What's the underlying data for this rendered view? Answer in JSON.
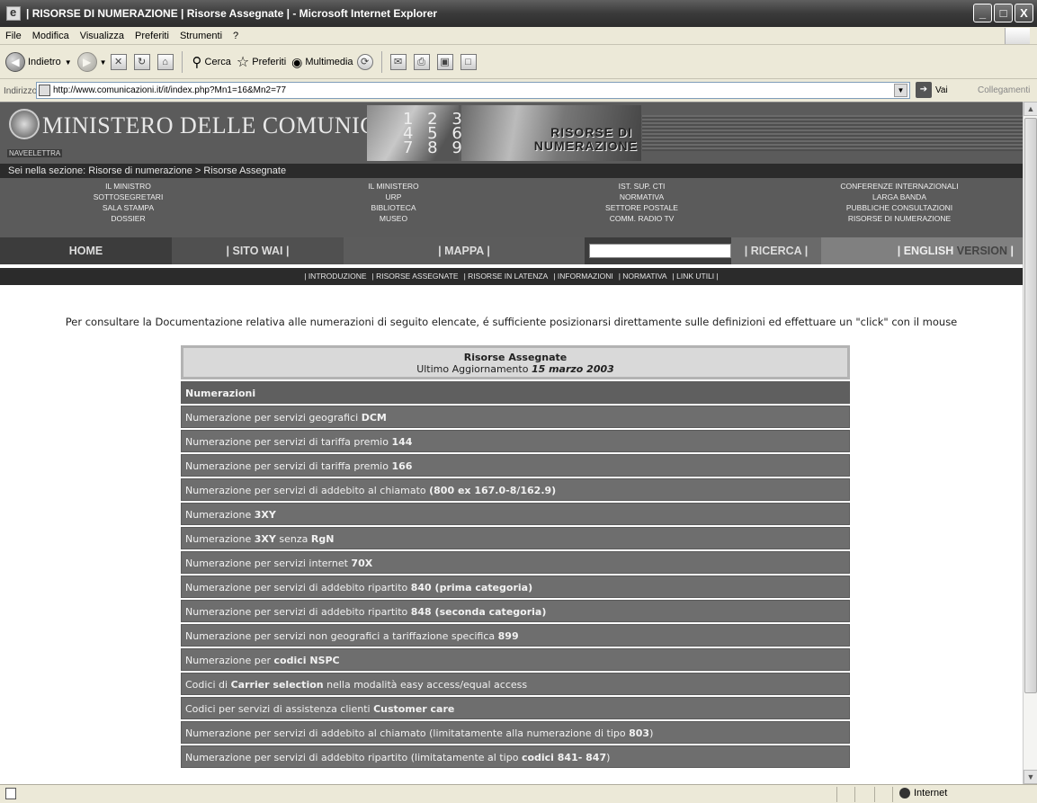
{
  "window": {
    "title": "| RISORSE DI NUMERAZIONE | Risorse Assegnate | - Microsoft Internet Explorer",
    "controls": [
      "_",
      "□",
      "X"
    ]
  },
  "menu": [
    "File",
    "Modifica",
    "Visualizza",
    "Preferiti",
    "Strumenti",
    "?"
  ],
  "toolbar": {
    "back": "Indietro",
    "search": "Cerca",
    "favorites": "Preferiti",
    "multimedia": "Multimedia"
  },
  "address": {
    "label": "Indirizzo",
    "url": "http://www.comunicazioni.it/it/index.php?Mn1=16&Mn2=77",
    "go": "Vai",
    "links": "Collegamenti"
  },
  "site": {
    "logo": "MINISTERO DELLE COMUNICAZIONI",
    "logo_sub": "NAVEELETTRA",
    "banner_digits": "1 2 3\n4 5 6\n7 8 9",
    "banner_line1": "RISORSE DI",
    "banner_line2": "NUMERAZIONE",
    "breadcrumb": "Sei nella sezione: Risorse di numerazione > Risorse Assegnate",
    "topnav": [
      [
        "IL MINISTRO",
        "SOTTOSEGRETARI",
        "SALA STAMPA",
        "DOSSIER"
      ],
      [
        "IL MINISTERO",
        "URP",
        "BIBLIOTECA",
        "MUSEO"
      ],
      [
        "IST. SUP. CTI",
        "NORMATIVA",
        "SETTORE POSTALE",
        "COMM. RADIO TV"
      ],
      [
        "CONFERENZE INTERNAZIONALI",
        "LARGA BANDA",
        "PUBBLICHE CONSULTAZIONI",
        "RISORSE DI NUMERAZIONE"
      ]
    ],
    "mainnav": {
      "home": "HOME",
      "sito": "| SITO WAI |",
      "mappa": "| MAPPA |",
      "ricerca": "| RICERCA |",
      "english": "| ENGLISH ",
      "version": "VERSION",
      "version_end": " |"
    },
    "subnav": [
      "| INTRODUZIONE",
      "| RISORSE ASSEGNATE",
      "| RISORSE IN LATENZA",
      "| INFORMAZIONI",
      "| NORMATIVA",
      "| LINK UTILI |"
    ],
    "intro": "Per consultare la Documentazione relativa alle numerazioni di seguito elencate, é sufficiente posizionarsi direttamente sulle definizioni ed effettuare un \"click\" con il mouse"
  },
  "table": {
    "title": "Risorse Assegnate",
    "updated_label": "Ultimo Aggiornamento ",
    "updated_date": "15 marzo 2003",
    "header": "Numerazioni",
    "rows": [
      {
        "pre": "Numerazione per servizi geografici ",
        "bold": "DCM",
        "post": ""
      },
      {
        "pre": "Numerazione per servizi di tariffa premio ",
        "bold": "144",
        "post": ""
      },
      {
        "pre": "Numerazione per servizi di tariffa premio ",
        "bold": "166",
        "post": ""
      },
      {
        "pre": "Numerazione per servizi di addebito al chiamato ",
        "bold": "(800 ex 167.0-8/162.9)",
        "post": ""
      },
      {
        "pre": "Numerazione ",
        "bold": "3XY",
        "post": ""
      },
      {
        "pre": "Numerazione ",
        "bold": "3XY",
        "post": " senza ",
        "bold2": "RgN"
      },
      {
        "pre": "Numerazione per servizi internet ",
        "bold": "70X",
        "post": ""
      },
      {
        "pre": "Numerazione per servizi di addebito ripartito ",
        "bold": "840 (prima categoria)",
        "post": ""
      },
      {
        "pre": "Numerazione per servizi di addebito ripartito ",
        "bold": "848 (seconda categoria)",
        "post": ""
      },
      {
        "pre": "Numerazione per servizi non geografici a tariffazione specifica ",
        "bold": "899",
        "post": ""
      },
      {
        "pre": "Numerazione per ",
        "bold": "codici NSPC",
        "post": ""
      },
      {
        "pre": "Codici di ",
        "bold": "Carrier selection",
        "post": " nella modalità easy access/equal access"
      },
      {
        "pre": "Codici per servizi di assistenza clienti ",
        "bold": "Customer care",
        "post": ""
      },
      {
        "pre": "Numerazione per servizi di addebito al chiamato (limitatamente alla  numerazione di tipo ",
        "bold": "803",
        "post": ")"
      },
      {
        "pre": "Numerazione per servizi di addebito ripartito (limitatamente al tipo ",
        "bold": "codici 841- 847",
        "post": ")"
      }
    ]
  },
  "status": {
    "zone": "Internet"
  }
}
